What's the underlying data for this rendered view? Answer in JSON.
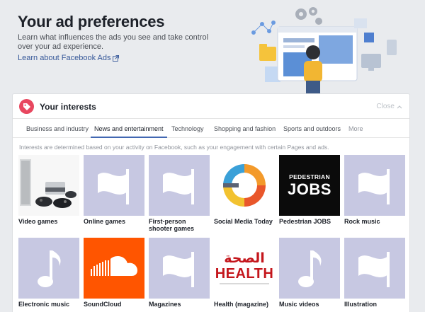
{
  "hero": {
    "title": "Your ad preferences",
    "description": "Learn what influences the ads you see and take control over your ad experience.",
    "learn_link": "Learn about Facebook Ads"
  },
  "panel": {
    "title": "Your interests",
    "close_label": "Close",
    "hint": "Interests are determined based on your activity on Facebook, such as your engagement with certain Pages and ads."
  },
  "tabs": [
    {
      "label": "Business and industry",
      "active": false
    },
    {
      "label": "News and entertainment",
      "active": true
    },
    {
      "label": "Technology",
      "active": false
    },
    {
      "label": "Shopping and fashion",
      "active": false
    },
    {
      "label": "Sports and outdoors",
      "active": false
    },
    {
      "label": "More",
      "active": false
    }
  ],
  "interests": [
    {
      "label": "Video games",
      "image": "video-games-photo"
    },
    {
      "label": "Online games",
      "image": "flag-placeholder"
    },
    {
      "label": "First-person shooter games",
      "image": "flag-placeholder"
    },
    {
      "label": "Social Media Today",
      "image": "social-media-today-logo"
    },
    {
      "label": "Pedestrian JOBS",
      "image": "pedestrian-jobs-logo",
      "logo_top": "PEDESTRIAN",
      "logo_bottom": "JOBS"
    },
    {
      "label": "Rock music",
      "image": "flag-placeholder"
    },
    {
      "label": "Electronic music",
      "image": "music-note-placeholder"
    },
    {
      "label": "SoundCloud",
      "image": "soundcloud-logo"
    },
    {
      "label": "Magazines",
      "image": "flag-placeholder"
    },
    {
      "label": "Health (magazine)",
      "image": "health-magazine-logo",
      "logo_arabic": "الصحة",
      "logo_english": "HEALTH"
    },
    {
      "label": "Music videos",
      "image": "music-note-placeholder"
    },
    {
      "label": "Illustration",
      "image": "flag-placeholder"
    }
  ],
  "colors": {
    "background": "#e9ebee",
    "link": "#365899",
    "tab_active": "#4267b2",
    "placeholder": "#c7c8e2",
    "badge": "#e8475f",
    "soundcloud": "#ff5500",
    "health_red": "#c4161c"
  }
}
